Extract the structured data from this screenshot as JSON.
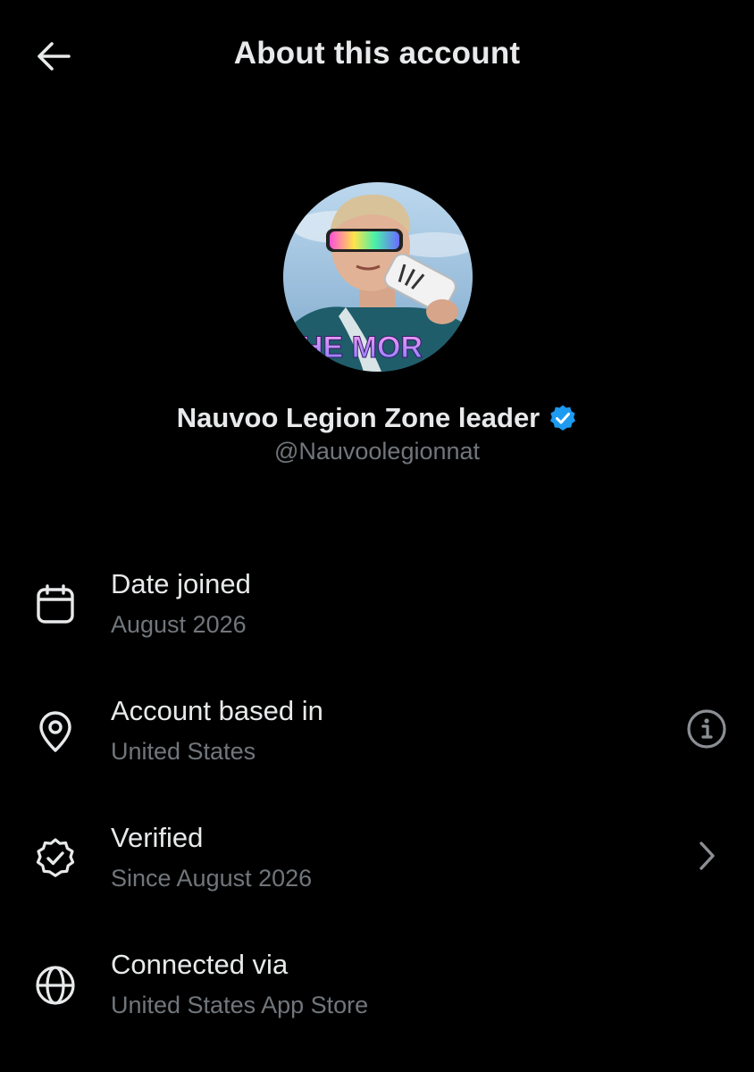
{
  "header": {
    "title": "About this account",
    "back_icon": "arrow-left-icon"
  },
  "profile": {
    "display_name": "Nauvoo Legion Zone leader",
    "handle": "@Nauvoolegionnat",
    "verified_color": "#1d9bf0",
    "avatar_text": "HE MOR"
  },
  "rows": [
    {
      "icon": "calendar-icon",
      "title": "Date joined",
      "value": "August 2026"
    },
    {
      "icon": "location-pin-icon",
      "title": "Account based in",
      "value": "United States",
      "action_icon": "info-icon"
    },
    {
      "icon": "verified-badge-outline-icon",
      "title": "Verified",
      "value": "Since August 2026",
      "action_icon": "chevron-right-icon"
    },
    {
      "icon": "globe-icon",
      "title": "Connected via",
      "value": "United States App Store"
    }
  ],
  "colors": {
    "background": "#000000",
    "primary_text": "#e7e9ea",
    "secondary_text": "#71767b",
    "accent": "#1d9bf0"
  }
}
